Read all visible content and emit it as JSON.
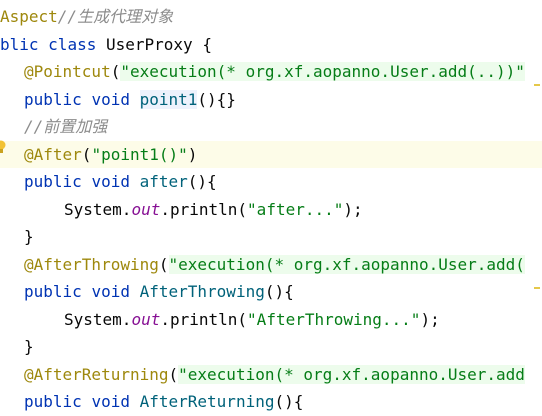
{
  "lines": [
    {
      "cut": "Aspect",
      "comment": "//生成代理对象"
    },
    {
      "kw1": "blic",
      "kw2": "class",
      "name": "UserProxy {"
    },
    {
      "ann": "@Pointcut",
      "open": "(",
      "str": "\"execution(* org.xf.aopanno.User.add(..))\""
    },
    {
      "kw1": "public",
      "kw2": "void",
      "name": "point1",
      "rest": "(){}"
    },
    {
      "comment": "//前置加强"
    },
    {
      "ann": "@After",
      "open": "(",
      "str": "\"point1()\"",
      "close": ")"
    },
    {
      "kw1": "public",
      "kw2": "void",
      "name": "after",
      "rest": "(){"
    },
    {
      "obj": "System.",
      "field": "out",
      "call": ".println(",
      "str": "\"after...\"",
      "close": ");"
    },
    {
      "text": "}"
    },
    {
      "ann": "@AfterThrowing",
      "open": "(",
      "str": "\"execution(* org.xf.aopanno.User.add("
    },
    {
      "kw1": "public",
      "kw2": "void",
      "name": "AfterThrowing",
      "rest": "(){"
    },
    {
      "obj": "System.",
      "field": "out",
      "call": ".println(",
      "str": "\"AfterThrowing...\"",
      "close": ");"
    },
    {
      "text": "}"
    },
    {
      "ann": "@AfterReturning",
      "open": "(",
      "str": "\"execution(* org.xf.aopanno.User.add"
    },
    {
      "kw1": "public",
      "kw2": "void",
      "name": "AfterReturning",
      "rest": "(){"
    }
  ],
  "icons": {
    "gutter": "lightbulb-icon"
  },
  "colors": {
    "keyword": "#0033b3",
    "annotation": "#9e880d",
    "string": "#067d17",
    "comment": "#8c8c8c",
    "field": "#871094",
    "method_decl": "#00627a",
    "current_line": "#fdfce8",
    "marker": "#e5c84a"
  }
}
